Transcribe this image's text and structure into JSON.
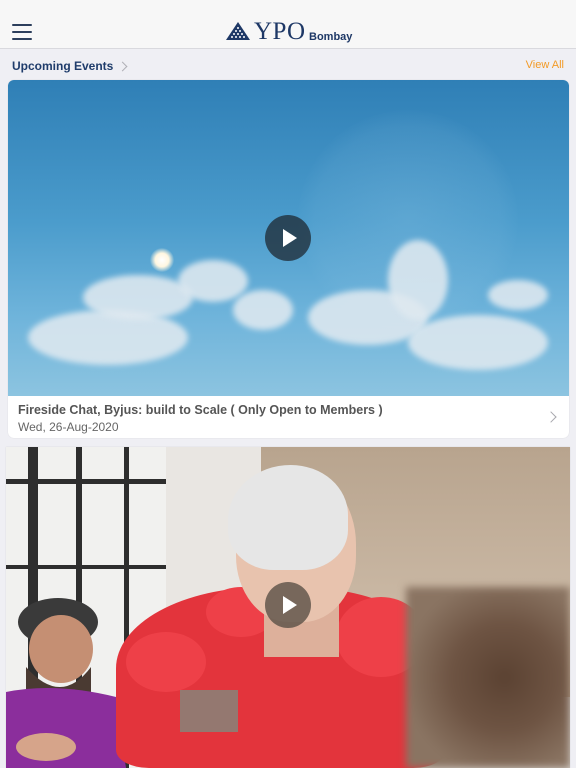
{
  "header": {
    "menu_icon": "hamburger-icon",
    "logo_icon": "ypo-pyramid-icon",
    "brand_name": "YPO",
    "chapter": "Bombay",
    "brand_color": "#1e3866"
  },
  "section": {
    "title": "Upcoming Events",
    "view_all": "View All",
    "accent_color": "#f29a26"
  },
  "events": [
    {
      "title": "Fireside Chat, Byjus: build to Scale ( Only Open to Members )",
      "date": "Wed, 26-Aug-2020",
      "media_icon": "play-icon"
    },
    {
      "title": "",
      "date": "",
      "media_icon": "play-icon"
    }
  ]
}
